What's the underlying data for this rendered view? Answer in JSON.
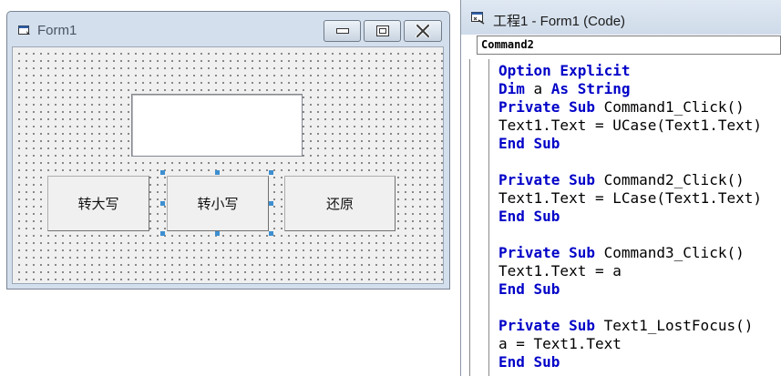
{
  "form_window": {
    "title": "Form1",
    "text_box_value": "",
    "buttons": {
      "command1": "转大写",
      "command2": "转小写",
      "command3": "还原"
    }
  },
  "code_window": {
    "title": "工程1 - Form1 (Code)",
    "object_selector": "Command2",
    "lines": [
      [
        {
          "t": "Option Explicit",
          "k": true
        }
      ],
      [
        {
          "t": "Dim ",
          "k": true
        },
        {
          "t": "a "
        },
        {
          "t": "As String",
          "k": true
        }
      ],
      [
        {
          "t": "Private Sub ",
          "k": true
        },
        {
          "t": "Command1_Click()"
        }
      ],
      [
        {
          "t": "Text1.Text = UCase(Text1.Text)"
        }
      ],
      [
        {
          "t": "End Sub",
          "k": true
        }
      ],
      [],
      [
        {
          "t": "Private Sub ",
          "k": true
        },
        {
          "t": "Command2_Click()"
        }
      ],
      [
        {
          "t": "Text1.Text = LCase(Text1.Text)"
        }
      ],
      [
        {
          "t": "End Sub",
          "k": true
        }
      ],
      [],
      [
        {
          "t": "Private Sub ",
          "k": true
        },
        {
          "t": "Command3_Click()"
        }
      ],
      [
        {
          "t": "Text1.Text = a"
        }
      ],
      [
        {
          "t": "End Sub",
          "k": true
        }
      ],
      [],
      [
        {
          "t": "Private Sub ",
          "k": true
        },
        {
          "t": "Text1_LostFocus()"
        }
      ],
      [
        {
          "t": "a = Text1.Text"
        }
      ],
      [
        {
          "t": "End Sub",
          "k": true
        }
      ]
    ]
  },
  "colors": {
    "keyword": "#0000c8",
    "selection_handle": "#3d8fd1"
  }
}
